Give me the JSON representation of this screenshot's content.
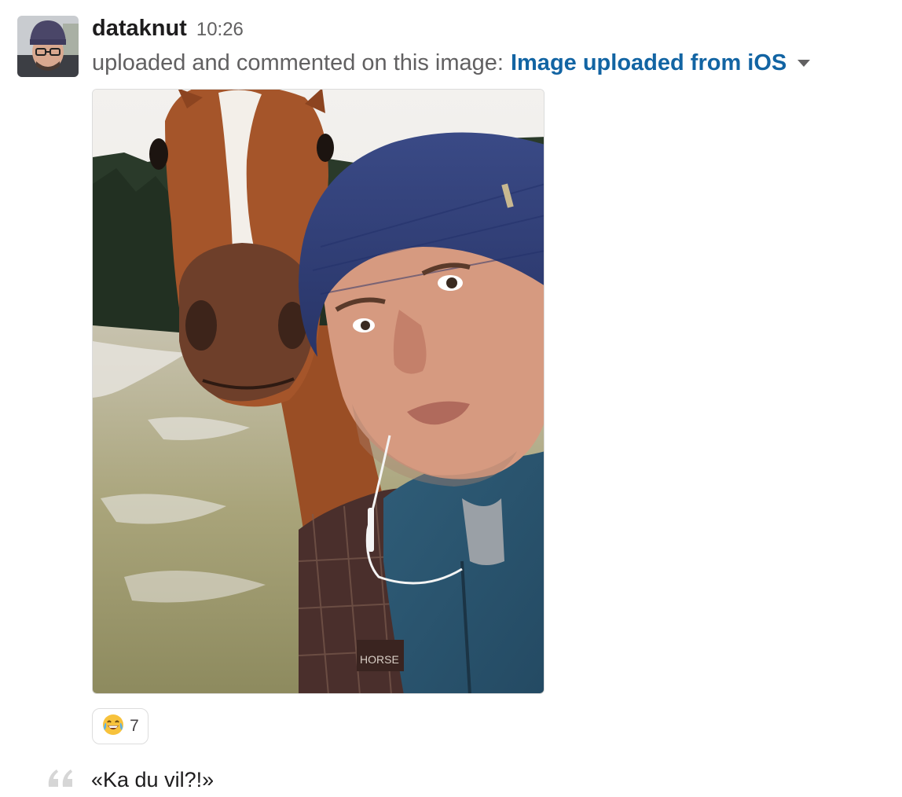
{
  "message": {
    "username": "dataknut",
    "timestamp": "10:26",
    "action_text": "uploaded and commented on this image:",
    "file_title": "Image uploaded from iOS",
    "reaction": {
      "emoji_icon": "joy-emoji-icon",
      "count": "7"
    },
    "comment": "«Ka du vil?!»"
  },
  "colors": {
    "link": "#1264a3",
    "muted": "#616061",
    "text": "#1d1c1d"
  }
}
